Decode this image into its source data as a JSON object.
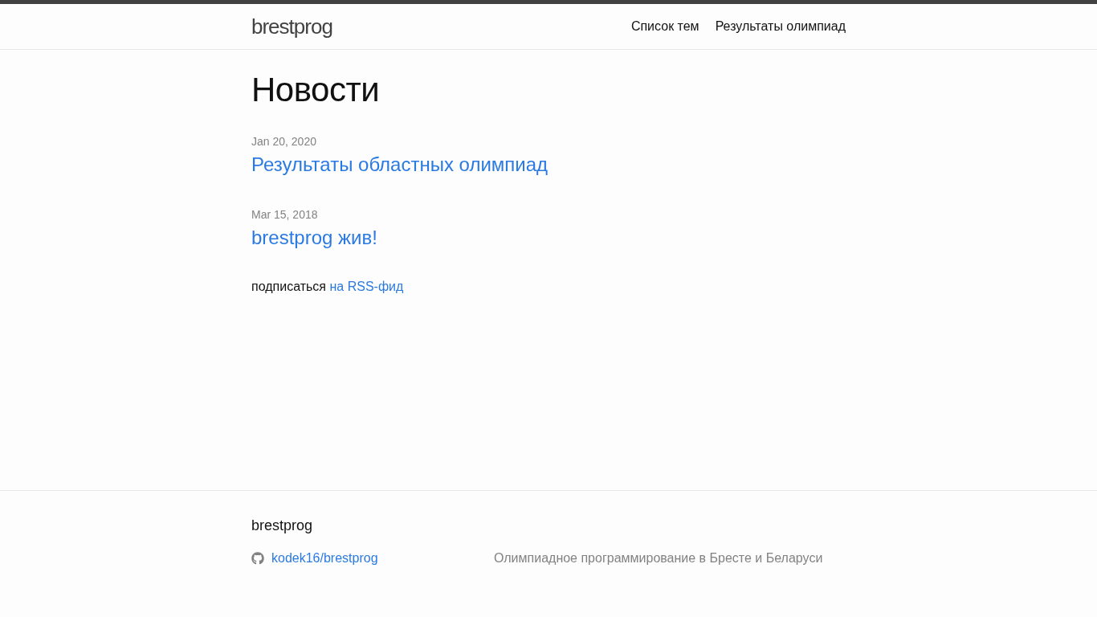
{
  "header": {
    "site_title": "brestprog",
    "nav": [
      {
        "label": "Список тем"
      },
      {
        "label": "Результаты олимпиад"
      }
    ]
  },
  "page": {
    "title": "Новости",
    "posts": [
      {
        "date": "Jan 20, 2020",
        "title": "Результаты областных олимпиад"
      },
      {
        "date": "Mar 15, 2018",
        "title": "brestprog жив!"
      }
    ],
    "rss": {
      "text": "подписаться",
      "link": "на RSS-фид"
    }
  },
  "footer": {
    "title": "brestprog",
    "github": "kodek16/brestprog",
    "description": "Олимпиадное программирование в Бресте и Беларуси"
  }
}
